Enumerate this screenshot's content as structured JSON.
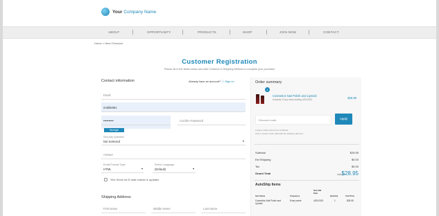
{
  "logo": {
    "brand_bold": "Your",
    "brand_rest": "Company Name"
  },
  "nav": [
    "ABOUT",
    "OPPORTUNITY",
    "PRODUCTS",
    "SHOP",
    "JOIN NOW",
    "CONTACT"
  ],
  "breadcrumb": "Home > New Checkout",
  "page": {
    "title": "Customer Registration",
    "subtitle": "Please fill in the fields below and click Continue to Shipping Method to complete your purchase"
  },
  "contact": {
    "heading": "Contact information",
    "already_text": "Already have an account?",
    "signin_label": "Sign in",
    "email_placeholder": "Email",
    "username_value": "mobile961",
    "password_value": "••••••••••",
    "confirm_password_placeholder": "Confirm Password",
    "password_strength": "Strength",
    "security_question_label": "Security Question",
    "security_question_value": "Not Selected",
    "answer_placeholder": "Answer",
    "email_format_label": "Email Format Type",
    "email_format_value": "HTML",
    "preferred_language_label": "Select Language",
    "preferred_language_value": "(Default)",
    "updates_label": "Yes! Send me E-mail notices & updates"
  },
  "shipping": {
    "heading": "Shipping Address",
    "first_name_placeholder": "First Name",
    "middle_name_placeholder": "Middle Name",
    "last_name_placeholder": "Last Name"
  },
  "order": {
    "heading": "Order summary",
    "item_qty": "1",
    "item_name": "Cosmetics Nail Polish and Lipstick",
    "item_sub": "Autoship: Every week starting 4/20/2023",
    "item_price": "$28.95",
    "discount_placeholder": "Discount code",
    "apply_label": "Apply",
    "coupon_note_1": "Coupon codes cannot be combined.",
    "coupon_note_2": "Only 1 coupon code valid with the shipping discount.",
    "rows": [
      {
        "label": "Subtotal",
        "value": "$28.95"
      },
      {
        "label": "Est Shipping",
        "value": "$0.00"
      },
      {
        "label": "Tax",
        "value": "$0.00"
      }
    ],
    "grand_label": "Grand Total",
    "grand_old": "$28.95",
    "grand_value": "$28.95",
    "autoship_heading": "AutoShip Items",
    "table_headers": [
      "Item Name",
      "Frequency",
      "Next Bill Date",
      "Quantity",
      "Unit Price"
    ],
    "table_row": [
      "Cosmetics Nail Polish and Lipstick",
      "Every week",
      "4/20/2023",
      "1",
      "$28.95"
    ]
  },
  "colors": {
    "accent": "#1e88b8",
    "input_filled": "#e8f0fb",
    "nav_bg": "#eeeeee"
  }
}
